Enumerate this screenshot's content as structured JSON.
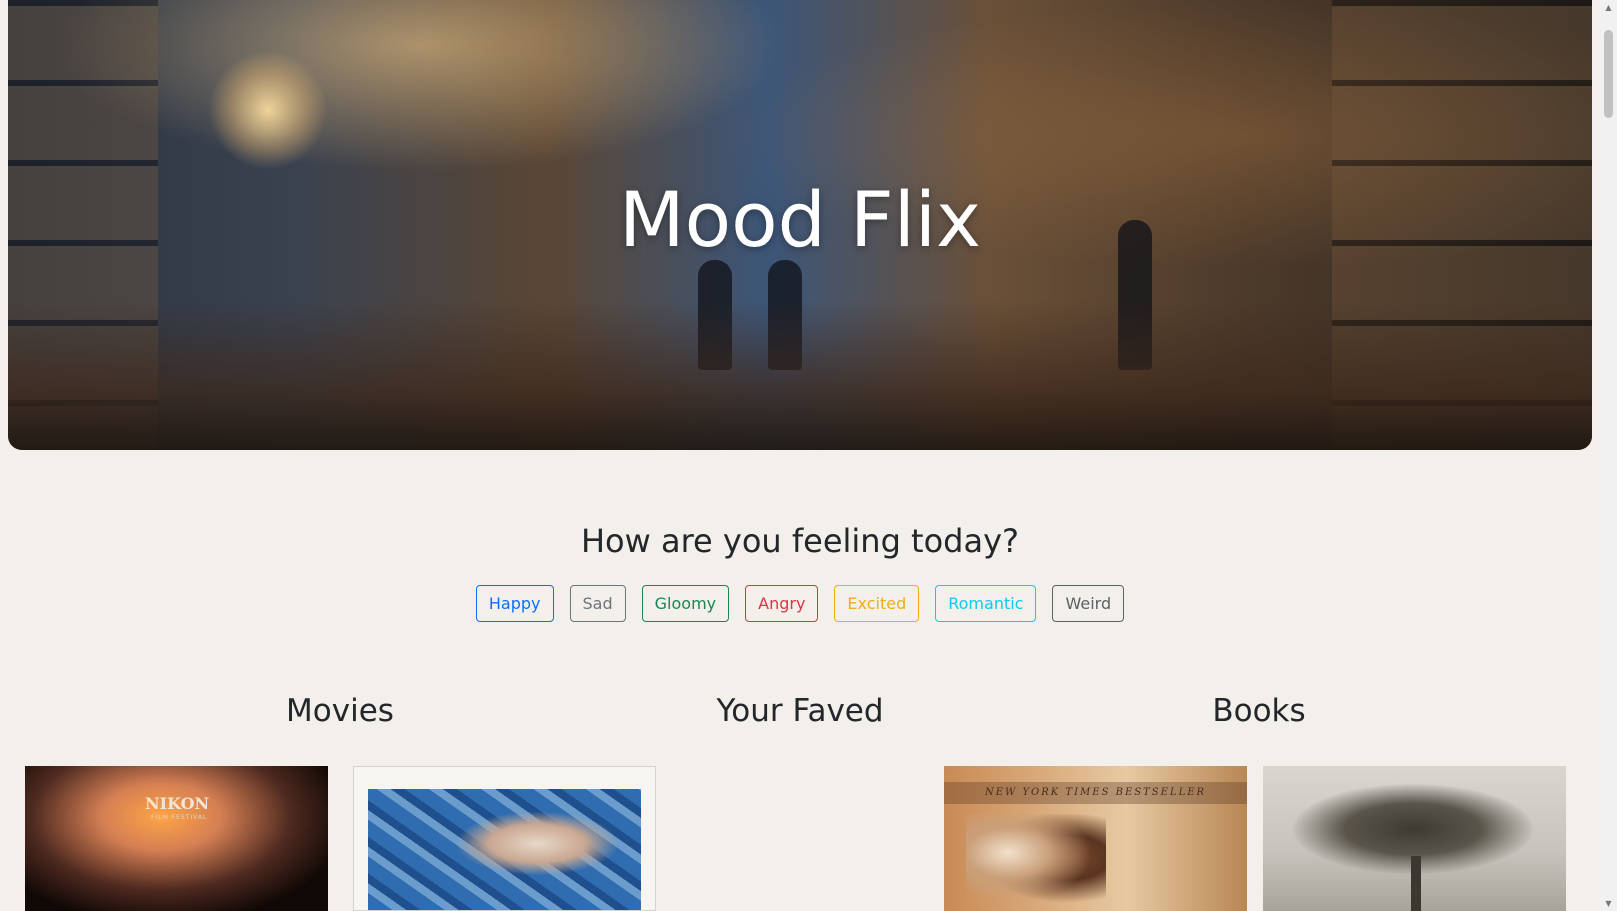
{
  "hero": {
    "title": "Mood Flix"
  },
  "mood_section": {
    "question": "How are you feeling today?",
    "moods": [
      {
        "label": "Happy",
        "color": "#0d6efd"
      },
      {
        "label": "Sad",
        "color": "#6c757d"
      },
      {
        "label": "Gloomy",
        "color": "#198754"
      },
      {
        "label": "Angry",
        "color": "#dc3545"
      },
      {
        "label": "Excited",
        "color": "#f0ad1b"
      },
      {
        "label": "Romantic",
        "color": "#0dcaf0"
      },
      {
        "label": "Weird",
        "color": "#5c6166"
      }
    ]
  },
  "columns": {
    "movies": {
      "title": "Movies"
    },
    "faved": {
      "title": "Your Faved"
    },
    "books": {
      "title": "Books"
    }
  },
  "posters": {
    "movie_1": {
      "badge": "NIKON",
      "badge_sub": "FILM FESTIVAL"
    },
    "book_1": {
      "banner": "NEW YORK TIMES BESTSELLER"
    }
  }
}
